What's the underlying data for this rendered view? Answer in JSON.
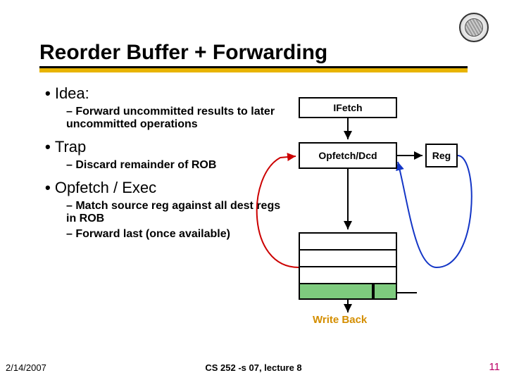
{
  "title": "Reorder Buffer + Forwarding",
  "bullets": [
    {
      "label": "Idea:",
      "subs": [
        "Forward uncommitted results to later uncommitted operations"
      ]
    },
    {
      "label": "Trap",
      "subs": [
        "Discard remainder of ROB"
      ]
    },
    {
      "label": "Opfetch / Exec",
      "subs": [
        "Match source reg against all dest regs in ROB",
        "Forward last (once available)"
      ]
    }
  ],
  "diagram": {
    "ifetch": "IFetch",
    "opfetch": "Opfetch/Dcd",
    "reg": "Reg",
    "writeback": "Write Back"
  },
  "footer": {
    "date": "2/14/2007",
    "course": "CS 252 -s 07, lecture 8",
    "page": "11"
  }
}
